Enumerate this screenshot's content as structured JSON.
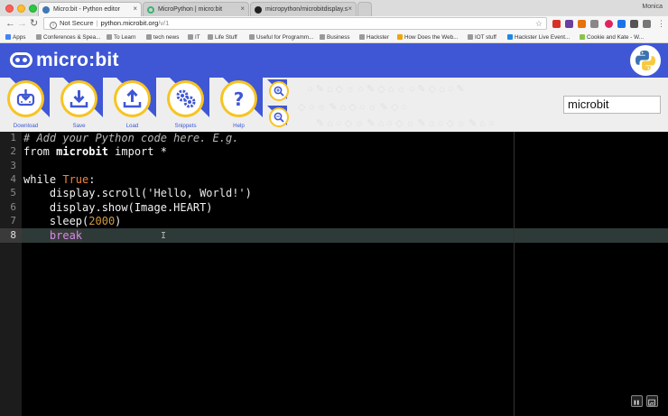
{
  "browser": {
    "tabs": [
      {
        "title": "Micro:bit - Python editor",
        "active": true
      },
      {
        "title": "MicroPython | micro:bit",
        "active": false
      },
      {
        "title": "micropython/microbitdisplay.s",
        "active": false
      }
    ],
    "tab_close": "×",
    "profile": "Monica",
    "address": {
      "security": "Not Secure",
      "host": "python.microbit.org",
      "path": "/v/1"
    },
    "bookmarks": [
      "Apps",
      "Conferences & Spea...",
      "To Learn",
      "tech news",
      "IT",
      "Life Stuff",
      "Useful for Programm...",
      "Business",
      "Hackster",
      "How Does the Web...",
      "IOT stuff",
      "Hackster Live Event...",
      "Cookie and Kate - W..."
    ]
  },
  "app": {
    "logo": "micro:bit",
    "actions": [
      {
        "label": "Download",
        "icon": "download-icon"
      },
      {
        "label": "Save",
        "icon": "save-icon"
      },
      {
        "label": "Load",
        "icon": "load-icon"
      },
      {
        "label": "Snippets",
        "icon": "snippets-icon"
      },
      {
        "label": "Help",
        "icon": "help-icon"
      }
    ],
    "zoom_in_icon": "zoom-in-icon",
    "zoom_out_icon": "zoom-out-icon",
    "script_name": "microbit"
  },
  "editor": {
    "line_numbers": [
      "1",
      "2",
      "3",
      "4",
      "5",
      "6",
      "7",
      "8"
    ],
    "active_line": 8,
    "lines": [
      {
        "comment": "# Add your Python code here. E.g."
      },
      {
        "kw": "from ",
        "bold": "microbit",
        "rest": " import *"
      },
      {},
      {
        "kw": "while ",
        "true": "True",
        "rest": ":"
      },
      {
        "indent": "    ",
        "a": "display.scroll(",
        "str": "'Hello, World!'",
        "b": ")"
      },
      {
        "indent": "    ",
        "a": "display.show(Image.HEART)"
      },
      {
        "indent": "    ",
        "a": "sleep(",
        "num": "2000",
        "b": ")"
      },
      {
        "indent": "    ",
        "break": "break"
      }
    ]
  },
  "colors": {
    "brand_blue": "#3f57d5",
    "accent_yellow": "#f7c422",
    "editor_bg": "#000000"
  }
}
